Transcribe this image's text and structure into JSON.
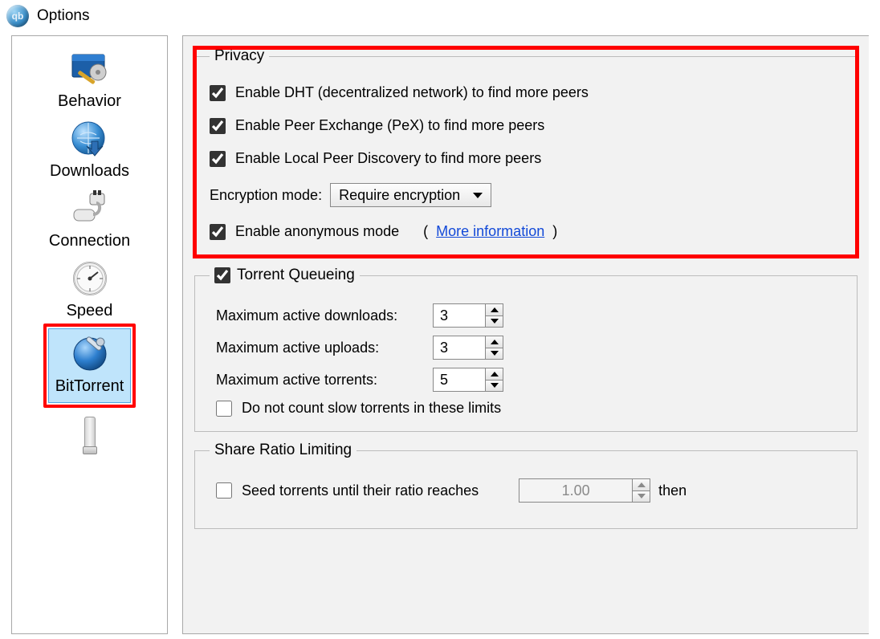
{
  "window": {
    "title": "Options"
  },
  "sidebar": {
    "items": [
      {
        "key": "behavior",
        "label": "Behavior"
      },
      {
        "key": "downloads",
        "label": "Downloads"
      },
      {
        "key": "connection",
        "label": "Connection"
      },
      {
        "key": "speed",
        "label": "Speed"
      },
      {
        "key": "bittorrent",
        "label": "BitTorrent",
        "selected": true
      }
    ]
  },
  "privacy": {
    "legend": "Privacy",
    "dht": {
      "label": "Enable DHT (decentralized network) to find more peers",
      "checked": true
    },
    "pex": {
      "label": "Enable Peer Exchange (PeX) to find more peers",
      "checked": true
    },
    "lpd": {
      "label": "Enable Local Peer Discovery to find more peers",
      "checked": true
    },
    "enc": {
      "label": "Encryption mode:",
      "value": "Require encryption"
    },
    "anon": {
      "label": "Enable anonymous mode",
      "checked": true,
      "more_open": "(",
      "more": "More information",
      "more_close": ")"
    }
  },
  "queue": {
    "legend": "Torrent Queueing",
    "enabled": true,
    "max_dl": {
      "label": "Maximum active downloads:",
      "value": "3"
    },
    "max_ul": {
      "label": "Maximum active uploads:",
      "value": "3"
    },
    "max_tr": {
      "label": "Maximum active torrents:",
      "value": "5"
    },
    "slow": {
      "label": "Do not count slow torrents in these limits",
      "checked": false
    }
  },
  "ratio": {
    "legend": "Share Ratio Limiting",
    "seed_until": {
      "label": "Seed torrents until their ratio reaches",
      "checked": false,
      "value": "1.00",
      "then": "then"
    }
  }
}
